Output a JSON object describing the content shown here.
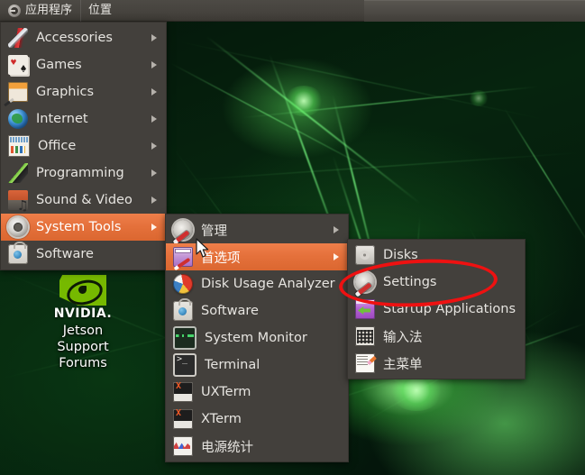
{
  "panel": {
    "logo_icon": "ubuntu-circle-icon",
    "items": [
      {
        "label": "应用程序",
        "name": "panel-applications"
      },
      {
        "label": "位置",
        "name": "panel-places"
      }
    ]
  },
  "menu_main": {
    "items": [
      {
        "label": "Accessories",
        "icon": "swiss-knife-icon",
        "arrow": true,
        "highlight": false
      },
      {
        "label": "Games",
        "icon": "playing-cards-icon",
        "arrow": true,
        "highlight": false
      },
      {
        "label": "Graphics",
        "icon": "graphics-icon",
        "arrow": true,
        "highlight": false
      },
      {
        "label": "Internet",
        "icon": "globe-icon",
        "arrow": true,
        "highlight": false
      },
      {
        "label": "Office",
        "icon": "spreadsheet-icon",
        "arrow": true,
        "highlight": false
      },
      {
        "label": "Programming",
        "icon": "trowel-icon",
        "arrow": true,
        "highlight": false
      },
      {
        "label": "Sound & Video",
        "icon": "sound-video-icon",
        "arrow": true,
        "highlight": false
      },
      {
        "label": "System Tools",
        "icon": "gear-icon",
        "arrow": true,
        "highlight": true
      },
      {
        "label": "Software",
        "icon": "software-bag-icon",
        "arrow": false,
        "highlight": false
      }
    ]
  },
  "menu_system_tools": {
    "items": [
      {
        "label": "管理",
        "icon": "gear-wrench-icon",
        "arrow": true,
        "highlight": false
      },
      {
        "label": "首选项",
        "icon": "preferences-icon",
        "arrow": true,
        "highlight": true
      },
      {
        "label": "Disk Usage Analyzer",
        "icon": "pie-chart-icon",
        "arrow": false,
        "highlight": false
      },
      {
        "label": "Software",
        "icon": "software-bag-icon",
        "arrow": false,
        "highlight": false
      },
      {
        "label": "System Monitor",
        "icon": "system-monitor-icon",
        "arrow": false,
        "highlight": false
      },
      {
        "label": "Terminal",
        "icon": "terminal-icon",
        "arrow": false,
        "highlight": false
      },
      {
        "label": "UXTerm",
        "icon": "xterm-icon",
        "arrow": false,
        "highlight": false
      },
      {
        "label": "XTerm",
        "icon": "xterm-icon",
        "arrow": false,
        "highlight": false
      },
      {
        "label": "电源统计",
        "icon": "power-statistics-icon",
        "arrow": false,
        "highlight": false
      }
    ]
  },
  "menu_preferences": {
    "items": [
      {
        "label": "Disks",
        "icon": "disk-icon",
        "arrow": false,
        "highlight": false
      },
      {
        "label": "Settings",
        "icon": "gear-wrench-icon",
        "arrow": false,
        "highlight": false
      },
      {
        "label": "Startup Applications",
        "icon": "startup-apps-icon",
        "arrow": false,
        "highlight": false
      },
      {
        "label": "输入法",
        "icon": "keyboard-icon",
        "arrow": false,
        "highlight": false
      },
      {
        "label": "主菜单",
        "icon": "main-menu-icon",
        "arrow": false,
        "highlight": false
      }
    ]
  },
  "desktop_icon": {
    "brand": "NVIDIA.",
    "line1": "Jetson",
    "line2": "Support",
    "line3": "Forums"
  },
  "annotation": {
    "shape": "ellipse",
    "color": "#ee1111",
    "target": "Settings"
  },
  "colors": {
    "menu_bg": "#43403c",
    "menu_text": "#e6e4e0",
    "highlight": "#e4703a",
    "panel_bg": "#46433e",
    "nvidia_green": "#76b900",
    "annotation_red": "#ee1111"
  }
}
